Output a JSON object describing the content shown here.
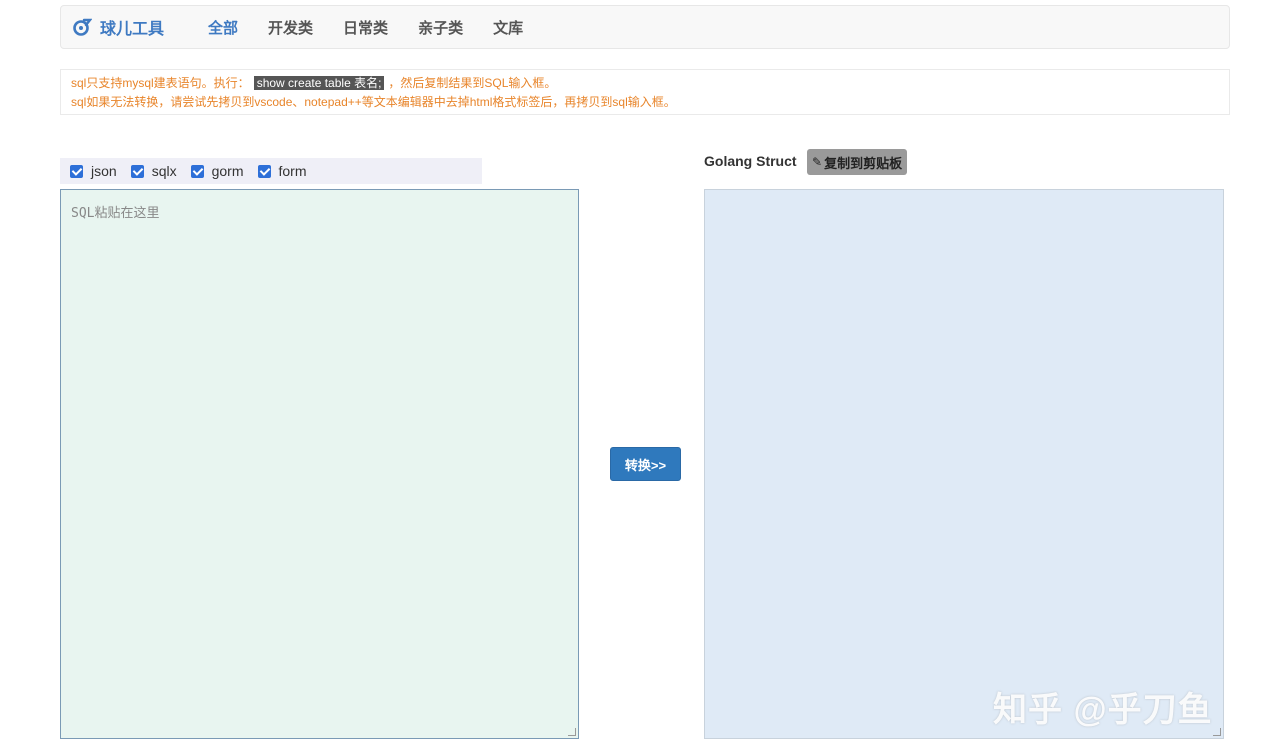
{
  "navbar": {
    "brand": "球儿工具",
    "links": [
      "全部",
      "开发类",
      "日常类",
      "亲子类",
      "文库"
    ]
  },
  "notice": {
    "line1_before": "sql只支持mysql建表语句。执行：",
    "line1_code": "show create table 表名;",
    "line1_after": "，然后复制结果到SQL输入框。",
    "line2": "sql如果无法转换，请尝试先拷贝到vscode、notepad++等文本编辑器中去掉html格式标签后，再拷贝到sql输入框。"
  },
  "options": [
    {
      "label": "json",
      "checked": true
    },
    {
      "label": "sqlx",
      "checked": true
    },
    {
      "label": "gorm",
      "checked": true
    },
    {
      "label": "form",
      "checked": true
    }
  ],
  "sql_input": {
    "placeholder": "SQL粘贴在这里",
    "value": ""
  },
  "convert_label": "转换>>",
  "output": {
    "label": "Golang Struct",
    "copy_label": "复制到剪贴板",
    "value": ""
  },
  "watermark": "知乎 @乎刀鱼",
  "colors": {
    "brand": "#3f7ac2",
    "notice_text": "#e8852b",
    "button": "#2f79bd",
    "input_bg": "#e8f5f0",
    "output_bg": "#dfeaf6"
  }
}
